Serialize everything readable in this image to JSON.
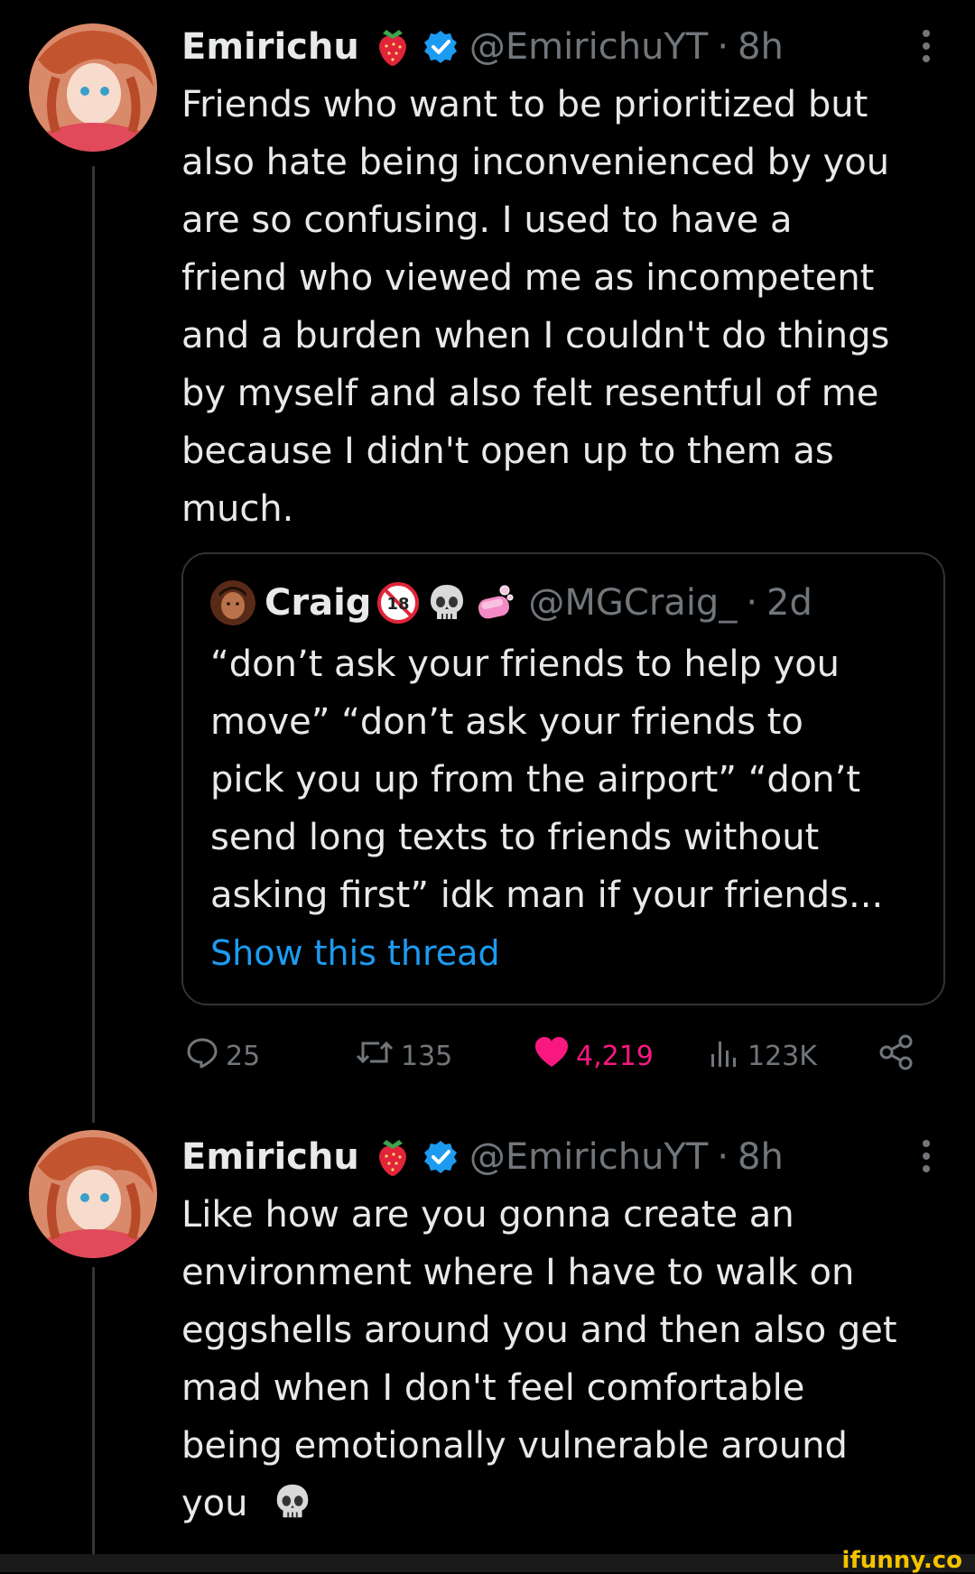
{
  "tweets": [
    {
      "name": "Emirichu",
      "handle": "@EmirichuYT",
      "separator": "·",
      "time": "8h",
      "lines": [
        "Friends who want to be prioritized but",
        "also hate being inconvenienced by you",
        "are so confusing. I used to have a",
        "friend who viewed me as incompetent",
        "and a burden when I couldn't do things",
        "by myself and also felt resentful of me",
        "because I didn't open up to them as",
        "much."
      ]
    },
    {
      "name": "Emirichu",
      "handle": "@EmirichuYT",
      "separator": "·",
      "time": "8h",
      "lines": [
        "Like how are you gonna create an",
        "environment where I have to walk on",
        "eggshells around you and then also get",
        "mad when I don't feel comfortable",
        "being emotionally vulnerable around",
        "you"
      ]
    }
  ],
  "quote": {
    "name": "Craig",
    "handle": "@MGCraig_",
    "separator": "·",
    "time": "2d",
    "lines": [
      "“don’t ask your friends to help you",
      "move” “don’t ask your friends to",
      "pick you up from the airport” “don’t",
      "send long texts to friends without",
      "asking first” idk man if your friends..."
    ],
    "show_thread": "Show this thread"
  },
  "actions": {
    "replies": "25",
    "retweets": "135",
    "likes": "4,219",
    "views": "123K"
  },
  "icons": {
    "strawberry": "strawberry-icon",
    "verified": "verified-badge-icon",
    "more": "more-options-icon",
    "skull": "skull-icon",
    "soap": "soap-icon",
    "under18": "under-18-icon",
    "reply": "reply-icon",
    "retweet": "retweet-icon",
    "like": "heart-icon",
    "views": "views-icon",
    "share": "share-icon"
  },
  "colors": {
    "background": "#000000",
    "text": "#e7e9ea",
    "muted": "#71767b",
    "link": "#1d9bf0",
    "like": "#f91880",
    "verified": "#1d9bf0"
  },
  "watermark": "ifunny.co"
}
